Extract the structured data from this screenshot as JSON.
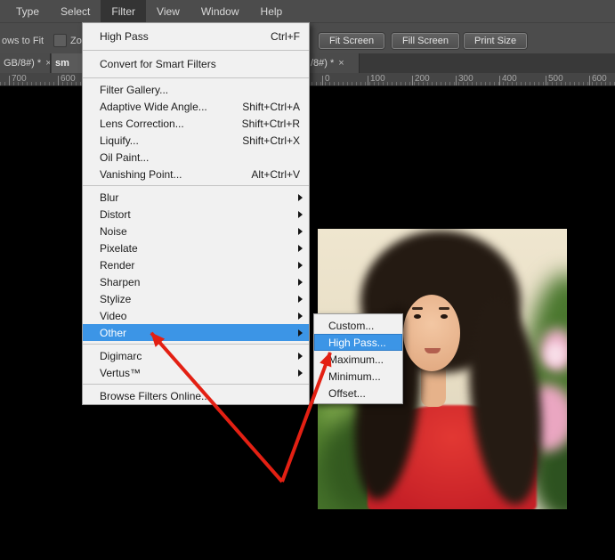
{
  "menubar": {
    "items": [
      {
        "label": "Type"
      },
      {
        "label": "Select"
      },
      {
        "label": "Filter",
        "active": true
      },
      {
        "label": "View"
      },
      {
        "label": "Window"
      },
      {
        "label": "Help"
      }
    ]
  },
  "options_bar": {
    "left_text_fragment": "ows to Fit",
    "checkbox_text_fragment": "Zoo",
    "buttons": [
      "Fit Screen",
      "Fill Screen",
      "Print Size"
    ]
  },
  "tabs": {
    "left": [
      {
        "label": "GB/8#) *",
        "close": "×"
      },
      {
        "label": "sm",
        "lighter": true
      }
    ],
    "right": [
      {
        "label": "/8#) *",
        "close": "×"
      }
    ]
  },
  "rulers": {
    "left": [
      "700",
      "600"
    ],
    "right": [
      "0",
      "100",
      "200",
      "300",
      "400",
      "500",
      "600"
    ]
  },
  "filter_menu": {
    "items": [
      {
        "label": "High Pass",
        "shortcut": "Ctrl+F"
      },
      {
        "separator": true
      },
      {
        "label": "Convert for Smart Filters"
      },
      {
        "separator": true
      },
      {
        "label": "Filter Gallery..."
      },
      {
        "label": "Adaptive Wide Angle...",
        "shortcut": "Shift+Ctrl+A"
      },
      {
        "label": "Lens Correction...",
        "shortcut": "Shift+Ctrl+R"
      },
      {
        "label": "Liquify...",
        "shortcut": "Shift+Ctrl+X"
      },
      {
        "label": "Oil Paint..."
      },
      {
        "label": "Vanishing Point...",
        "shortcut": "Alt+Ctrl+V"
      },
      {
        "separator": true
      },
      {
        "label": "Blur",
        "submenu": true
      },
      {
        "label": "Distort",
        "submenu": true
      },
      {
        "label": "Noise",
        "submenu": true
      },
      {
        "label": "Pixelate",
        "submenu": true
      },
      {
        "label": "Render",
        "submenu": true
      },
      {
        "label": "Sharpen",
        "submenu": true
      },
      {
        "label": "Stylize",
        "submenu": true
      },
      {
        "label": "Video",
        "submenu": true
      },
      {
        "label": "Other",
        "submenu": true,
        "highlighted": true
      },
      {
        "separator": true
      },
      {
        "label": "Digimarc",
        "submenu": true
      },
      {
        "label": "Vertus™",
        "submenu": true
      },
      {
        "separator": true
      },
      {
        "label": "Browse Filters Online..."
      }
    ]
  },
  "other_submenu": {
    "items": [
      {
        "label": "Custom..."
      },
      {
        "label": "High Pass...",
        "highlighted": true
      },
      {
        "label": "Maximum..."
      },
      {
        "label": "Minimum..."
      },
      {
        "label": "Offset..."
      }
    ]
  },
  "colors": {
    "menu_highlight": "#3c95e6",
    "annotation_arrow": "#e32013",
    "menu_bg": "#f1f1f1",
    "chrome_bg": "#4c4c4c"
  }
}
